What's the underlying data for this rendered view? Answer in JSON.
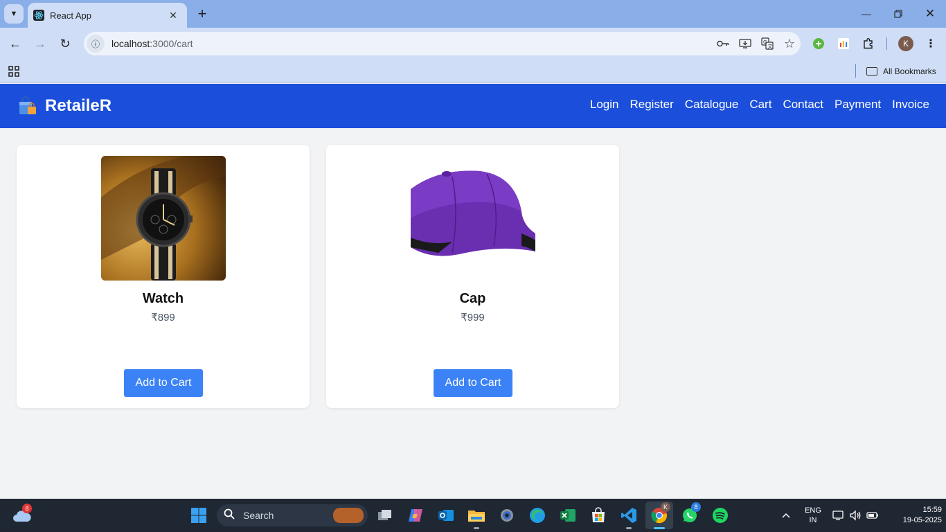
{
  "browser": {
    "tab_title": "React App",
    "url_host": "localhost",
    "url_path": ":3000/cart",
    "all_bookmarks": "All Bookmarks",
    "profile_initial": "K"
  },
  "app": {
    "brand": "RetaileR",
    "nav": [
      "Login",
      "Register",
      "Catalogue",
      "Cart",
      "Contact",
      "Payment",
      "Invoice"
    ],
    "accent": "#1b4fdb",
    "button_color": "#3b82f6",
    "products": [
      {
        "name": "Watch",
        "price": "₹899",
        "button": "Add to Cart"
      },
      {
        "name": "Cap",
        "price": "₹999",
        "button": "Add to Cart"
      }
    ]
  },
  "taskbar": {
    "weather_badge": "8",
    "search_label": "Search",
    "whatsapp_badge": "8",
    "lang_line1": "ENG",
    "lang_line2": "IN",
    "time": "15:59",
    "date": "19-05-2025",
    "icons": [
      "windows-start-icon",
      "search-icon",
      "task-view-icon",
      "copilot-icon",
      "outlook-icon",
      "file-explorer-icon",
      "settings-icon",
      "edge-icon",
      "excel-icon",
      "store-icon",
      "vscode-icon",
      "chrome-icon",
      "whatsapp-icon",
      "spotify-icon"
    ]
  }
}
